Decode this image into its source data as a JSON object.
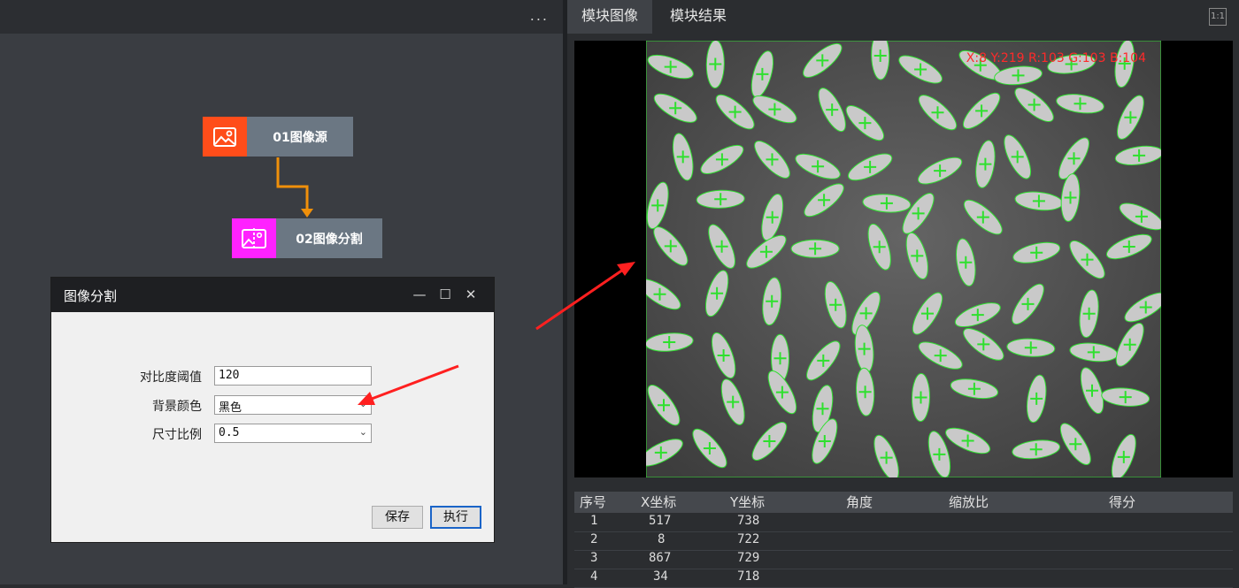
{
  "left_panel": {
    "menu_dots": "..."
  },
  "nodes": [
    {
      "label": "01图像源",
      "icon": "image-icon",
      "color": "#ff4d1a"
    },
    {
      "label": "02图像分割",
      "icon": "image-split-icon",
      "color": "#ff22ff"
    }
  ],
  "dialog": {
    "title": "图像分割",
    "minimize": "—",
    "maximize": "☐",
    "close": "✕",
    "fields": [
      {
        "label": "对比度阈值",
        "value": "120"
      },
      {
        "label": "背景颜色",
        "value": "黑色"
      },
      {
        "label": "尺寸比例",
        "value": "0.5"
      }
    ],
    "save_label": "保存",
    "run_label": "执行"
  },
  "right_panel": {
    "tabs": [
      "模块图像",
      "模块结果"
    ],
    "fit_label": "1:1",
    "pixel_readout": "X:8 Y:219  R:103 G:103 B:104"
  },
  "result_table": {
    "headers": [
      "序号",
      "X坐标",
      "Y坐标",
      "角度",
      "缩放比",
      "得分"
    ],
    "rows": [
      [
        "1",
        "517",
        "738"
      ],
      [
        "2",
        "8",
        "722"
      ],
      [
        "3",
        "867",
        "729"
      ],
      [
        "4",
        "34",
        "718"
      ]
    ]
  },
  "colors": {
    "accent_arrow": "#ff2020",
    "connector": "#f0900a",
    "marker": "#2ee02e"
  }
}
